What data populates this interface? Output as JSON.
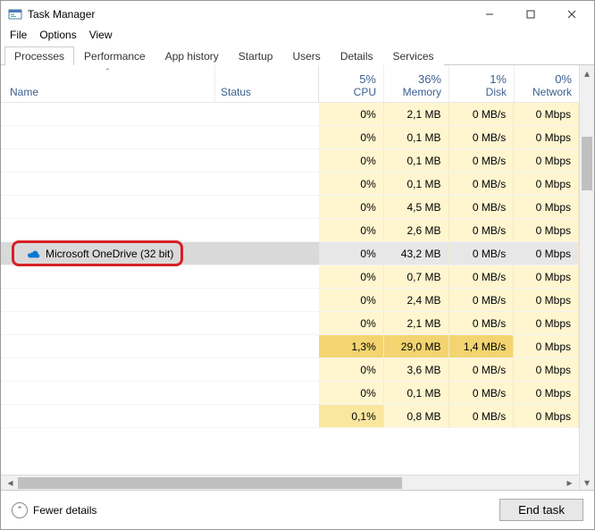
{
  "window": {
    "title": "Task Manager",
    "minimize_label": "—",
    "maximize_label": "▢",
    "close_label": "✕"
  },
  "menu": {
    "file": "File",
    "options": "Options",
    "view": "View"
  },
  "tabs": {
    "processes": "Processes",
    "performance": "Performance",
    "app_history": "App history",
    "startup": "Startup",
    "users": "Users",
    "details": "Details",
    "services": "Services"
  },
  "headers": {
    "name": "Name",
    "status": "Status",
    "cpu_pct": "5%",
    "cpu_lbl": "CPU",
    "mem_pct": "36%",
    "mem_lbl": "Memory",
    "disk_pct": "1%",
    "disk_lbl": "Disk",
    "net_pct": "0%",
    "net_lbl": "Network"
  },
  "rows": [
    {
      "name": "",
      "cpu": "0%",
      "mem": "2,1 MB",
      "disk": "0 MB/s",
      "net": "0 Mbps",
      "blurred": true
    },
    {
      "name": "",
      "cpu": "0%",
      "mem": "0,1 MB",
      "disk": "0 MB/s",
      "net": "0 Mbps",
      "blurred": true
    },
    {
      "name": "",
      "cpu": "0%",
      "mem": "0,1 MB",
      "disk": "0 MB/s",
      "net": "0 Mbps",
      "blurred": true
    },
    {
      "name": "",
      "cpu": "0%",
      "mem": "0,1 MB",
      "disk": "0 MB/s",
      "net": "0 Mbps",
      "blurred": true
    },
    {
      "name": "",
      "cpu": "0%",
      "mem": "4,5 MB",
      "disk": "0 MB/s",
      "net": "0 Mbps",
      "blurred": true
    },
    {
      "name": "",
      "cpu": "0%",
      "mem": "2,6 MB",
      "disk": "0 MB/s",
      "net": "0 Mbps",
      "blurred": true
    },
    {
      "name": "Microsoft OneDrive (32 bit)",
      "cpu": "0%",
      "mem": "43,2 MB",
      "disk": "0 MB/s",
      "net": "0 Mbps",
      "selected": true,
      "icon": "onedrive"
    },
    {
      "name": "",
      "cpu": "0%",
      "mem": "0,7 MB",
      "disk": "0 MB/s",
      "net": "0 Mbps",
      "blurred": true
    },
    {
      "name": "",
      "cpu": "0%",
      "mem": "2,4 MB",
      "disk": "0 MB/s",
      "net": "0 Mbps",
      "blurred": true
    },
    {
      "name": "",
      "cpu": "0%",
      "mem": "2,1 MB",
      "disk": "0 MB/s",
      "net": "0 Mbps",
      "blurred": true
    },
    {
      "name": "",
      "cpu": "1,3%",
      "mem": "29,0 MB",
      "disk": "1,4 MB/s",
      "net": "0 Mbps",
      "blurred": true,
      "hot": true
    },
    {
      "name": "",
      "cpu": "0%",
      "mem": "3,6 MB",
      "disk": "0 MB/s",
      "net": "0 Mbps",
      "blurred": true
    },
    {
      "name": "",
      "cpu": "0%",
      "mem": "0,1 MB",
      "disk": "0 MB/s",
      "net": "0 Mbps",
      "blurred": true
    },
    {
      "name": "",
      "cpu": "0,1%",
      "mem": "0,8 MB",
      "disk": "0 MB/s",
      "net": "0 Mbps",
      "blurred": true,
      "warm": true
    }
  ],
  "footer": {
    "fewer": "Fewer details",
    "end_task": "End task"
  }
}
